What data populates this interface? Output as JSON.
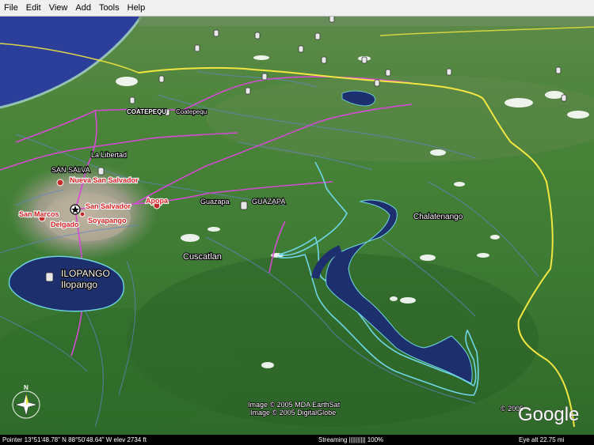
{
  "menu": [
    "File",
    "Edit",
    "View",
    "Add",
    "Tools",
    "Help"
  ],
  "places": {
    "coatepeque_caps": "COATEPEQU",
    "coatepeque": "Coatepequ",
    "la_libertad": "La Libertad",
    "san_salva": "SAN SALVA",
    "nueva_san_salvador": "Nueva San Salvador",
    "san_salvador": "San Salvador",
    "apopa": "Apopa",
    "san_marcos": "San Marcos",
    "soyapango": "Soyapango",
    "delgado": "Delgado",
    "guazapa": "Guazapa",
    "guazapa_caps": "GUAZAPA",
    "chalatenango": "Chalatenango",
    "cuscatlan": "Cuscatlan",
    "ilopango_caps": "ILOPANGO",
    "ilopango": "Ilopango"
  },
  "credits": {
    "line1": "Image © 2005 MDA EarthSat",
    "line2": "Image © 2005 DigitalGlobe",
    "google_small": "© 2005",
    "google_logo": "Google"
  },
  "compass": {
    "n": "N"
  },
  "status": {
    "pointer": "Pointer  13°51'48.78\" N    88°50'48.64\" W    elev  2734 ft",
    "streaming": "Streaming |||||||||| 100%",
    "eye": "Eye  alt     22.75 mi"
  },
  "colors": {
    "land": "#3a7432",
    "reservoir": "#1e2f6e",
    "ocean": "#2b3f9a",
    "border_yellow": "#f2e640",
    "road_magenta": "#d54ad4",
    "river": "#6fd6e6"
  },
  "icons": {
    "placemark": "placemark-icon",
    "capital": "capital-star-icon",
    "town": "town-dot-icon",
    "compass": "compass-icon"
  }
}
